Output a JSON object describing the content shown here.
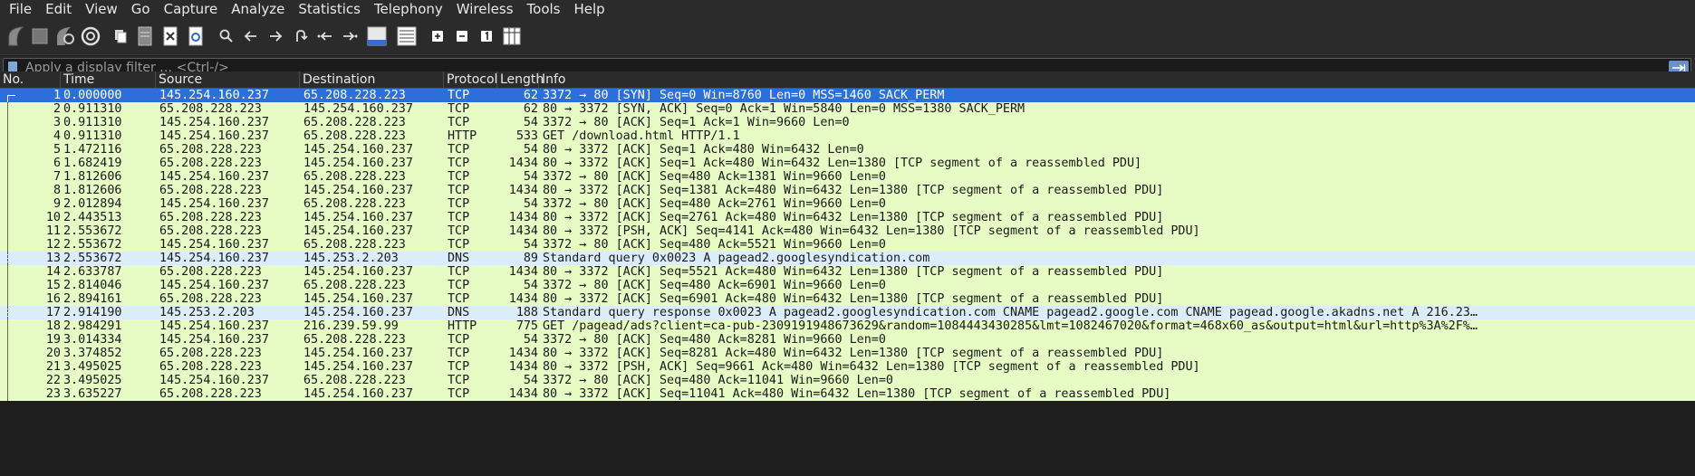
{
  "menu": [
    "File",
    "Edit",
    "View",
    "Go",
    "Capture",
    "Analyze",
    "Statistics",
    "Telephony",
    "Wireless",
    "Tools",
    "Help"
  ],
  "toolbar": {
    "icons": [
      "start-capture-icon",
      "stop-capture-icon",
      "restart-capture-icon",
      "capture-options-icon",
      "open-file-icon",
      "save-file-icon",
      "close-file-icon",
      "reload-file-icon",
      "find-packet-icon",
      "go-back-icon",
      "go-forward-icon",
      "go-to-packet-icon",
      "first-packet-icon",
      "last-packet-icon",
      "auto-scroll-icon",
      "colorize-icon",
      "zoom-in-icon",
      "zoom-out-icon",
      "normal-size-icon",
      "resize-columns-icon"
    ]
  },
  "filter": {
    "placeholder": "Apply a display filter … <Ctrl-/>",
    "value": ""
  },
  "columns": [
    "No.",
    "Time",
    "Source",
    "Destination",
    "Protocol",
    "Length",
    "Info"
  ],
  "colors": {
    "tcp": "#e7fbc4",
    "dns": "#dbecfb",
    "selected": "#2c6fd8",
    "selected_text": "#ffffff"
  },
  "selected_row": 1,
  "packets": [
    {
      "no": "1",
      "time": "0.000000",
      "src": "145.254.160.237",
      "dst": "65.208.228.223",
      "proto": "TCP",
      "len": "62",
      "info": "3372 → 80 [SYN] Seq=0 Win=8760 Len=0 MSS=1460 SACK_PERM",
      "kind": "tcp"
    },
    {
      "no": "2",
      "time": "0.911310",
      "src": "65.208.228.223",
      "dst": "145.254.160.237",
      "proto": "TCP",
      "len": "62",
      "info": "80 → 3372 [SYN, ACK] Seq=0 Ack=1 Win=5840 Len=0 MSS=1380 SACK_PERM",
      "kind": "tcp"
    },
    {
      "no": "3",
      "time": "0.911310",
      "src": "145.254.160.237",
      "dst": "65.208.228.223",
      "proto": "TCP",
      "len": "54",
      "info": "3372 → 80 [ACK] Seq=1 Ack=1 Win=9660 Len=0",
      "kind": "tcp"
    },
    {
      "no": "4",
      "time": "0.911310",
      "src": "145.254.160.237",
      "dst": "65.208.228.223",
      "proto": "HTTP",
      "len": "533",
      "info": "GET /download.html HTTP/1.1",
      "kind": "tcp"
    },
    {
      "no": "5",
      "time": "1.472116",
      "src": "65.208.228.223",
      "dst": "145.254.160.237",
      "proto": "TCP",
      "len": "54",
      "info": "80 → 3372 [ACK] Seq=1 Ack=480 Win=6432 Len=0",
      "kind": "tcp"
    },
    {
      "no": "6",
      "time": "1.682419",
      "src": "65.208.228.223",
      "dst": "145.254.160.237",
      "proto": "TCP",
      "len": "1434",
      "info": "80 → 3372 [ACK] Seq=1 Ack=480 Win=6432 Len=1380 [TCP segment of a reassembled PDU]",
      "kind": "tcp"
    },
    {
      "no": "7",
      "time": "1.812606",
      "src": "145.254.160.237",
      "dst": "65.208.228.223",
      "proto": "TCP",
      "len": "54",
      "info": "3372 → 80 [ACK] Seq=480 Ack=1381 Win=9660 Len=0",
      "kind": "tcp"
    },
    {
      "no": "8",
      "time": "1.812606",
      "src": "65.208.228.223",
      "dst": "145.254.160.237",
      "proto": "TCP",
      "len": "1434",
      "info": "80 → 3372 [ACK] Seq=1381 Ack=480 Win=6432 Len=1380 [TCP segment of a reassembled PDU]",
      "kind": "tcp"
    },
    {
      "no": "9",
      "time": "2.012894",
      "src": "145.254.160.237",
      "dst": "65.208.228.223",
      "proto": "TCP",
      "len": "54",
      "info": "3372 → 80 [ACK] Seq=480 Ack=2761 Win=9660 Len=0",
      "kind": "tcp"
    },
    {
      "no": "10",
      "time": "2.443513",
      "src": "65.208.228.223",
      "dst": "145.254.160.237",
      "proto": "TCP",
      "len": "1434",
      "info": "80 → 3372 [ACK] Seq=2761 Ack=480 Win=6432 Len=1380 [TCP segment of a reassembled PDU]",
      "kind": "tcp"
    },
    {
      "no": "11",
      "time": "2.553672",
      "src": "65.208.228.223",
      "dst": "145.254.160.237",
      "proto": "TCP",
      "len": "1434",
      "info": "80 → 3372 [PSH, ACK] Seq=4141 Ack=480 Win=6432 Len=1380 [TCP segment of a reassembled PDU]",
      "kind": "tcp"
    },
    {
      "no": "12",
      "time": "2.553672",
      "src": "145.254.160.237",
      "dst": "65.208.228.223",
      "proto": "TCP",
      "len": "54",
      "info": "3372 → 80 [ACK] Seq=480 Ack=5521 Win=9660 Len=0",
      "kind": "tcp"
    },
    {
      "no": "13",
      "time": "2.553672",
      "src": "145.254.160.237",
      "dst": "145.253.2.203",
      "proto": "DNS",
      "len": "89",
      "info": "Standard query 0x0023 A pagead2.googlesyndication.com",
      "kind": "dns"
    },
    {
      "no": "14",
      "time": "2.633787",
      "src": "65.208.228.223",
      "dst": "145.254.160.237",
      "proto": "TCP",
      "len": "1434",
      "info": "80 → 3372 [ACK] Seq=5521 Ack=480 Win=6432 Len=1380 [TCP segment of a reassembled PDU]",
      "kind": "tcp"
    },
    {
      "no": "15",
      "time": "2.814046",
      "src": "145.254.160.237",
      "dst": "65.208.228.223",
      "proto": "TCP",
      "len": "54",
      "info": "3372 → 80 [ACK] Seq=480 Ack=6901 Win=9660 Len=0",
      "kind": "tcp"
    },
    {
      "no": "16",
      "time": "2.894161",
      "src": "65.208.228.223",
      "dst": "145.254.160.237",
      "proto": "TCP",
      "len": "1434",
      "info": "80 → 3372 [ACK] Seq=6901 Ack=480 Win=6432 Len=1380 [TCP segment of a reassembled PDU]",
      "kind": "tcp"
    },
    {
      "no": "17",
      "time": "2.914190",
      "src": "145.253.2.203",
      "dst": "145.254.160.237",
      "proto": "DNS",
      "len": "188",
      "info": "Standard query response 0x0023 A pagead2.googlesyndication.com CNAME pagead2.google.com CNAME pagead.google.akadns.net A 216.23…",
      "kind": "dns"
    },
    {
      "no": "18",
      "time": "2.984291",
      "src": "145.254.160.237",
      "dst": "216.239.59.99",
      "proto": "HTTP",
      "len": "775",
      "info": "GET /pagead/ads?client=ca-pub-2309191948673629&random=1084443430285&lmt=1082467020&format=468x60_as&output=html&url=http%3A%2F%…",
      "kind": "tcp"
    },
    {
      "no": "19",
      "time": "3.014334",
      "src": "145.254.160.237",
      "dst": "65.208.228.223",
      "proto": "TCP",
      "len": "54",
      "info": "3372 → 80 [ACK] Seq=480 Ack=8281 Win=9660 Len=0",
      "kind": "tcp"
    },
    {
      "no": "20",
      "time": "3.374852",
      "src": "65.208.228.223",
      "dst": "145.254.160.237",
      "proto": "TCP",
      "len": "1434",
      "info": "80 → 3372 [ACK] Seq=8281 Ack=480 Win=6432 Len=1380 [TCP segment of a reassembled PDU]",
      "kind": "tcp"
    },
    {
      "no": "21",
      "time": "3.495025",
      "src": "65.208.228.223",
      "dst": "145.254.160.237",
      "proto": "TCP",
      "len": "1434",
      "info": "80 → 3372 [PSH, ACK] Seq=9661 Ack=480 Win=6432 Len=1380 [TCP segment of a reassembled PDU]",
      "kind": "tcp"
    },
    {
      "no": "22",
      "time": "3.495025",
      "src": "145.254.160.237",
      "dst": "65.208.228.223",
      "proto": "TCP",
      "len": "54",
      "info": "3372 → 80 [ACK] Seq=480 Ack=11041 Win=9660 Len=0",
      "kind": "tcp"
    },
    {
      "no": "23",
      "time": "3.635227",
      "src": "65.208.228.223",
      "dst": "145.254.160.237",
      "proto": "TCP",
      "len": "1434",
      "info": "80 → 3372 [ACK] Seq=11041 Ack=480 Win=6432 Len=1380 [TCP segment of a reassembled PDU]",
      "kind": "tcp"
    }
  ]
}
